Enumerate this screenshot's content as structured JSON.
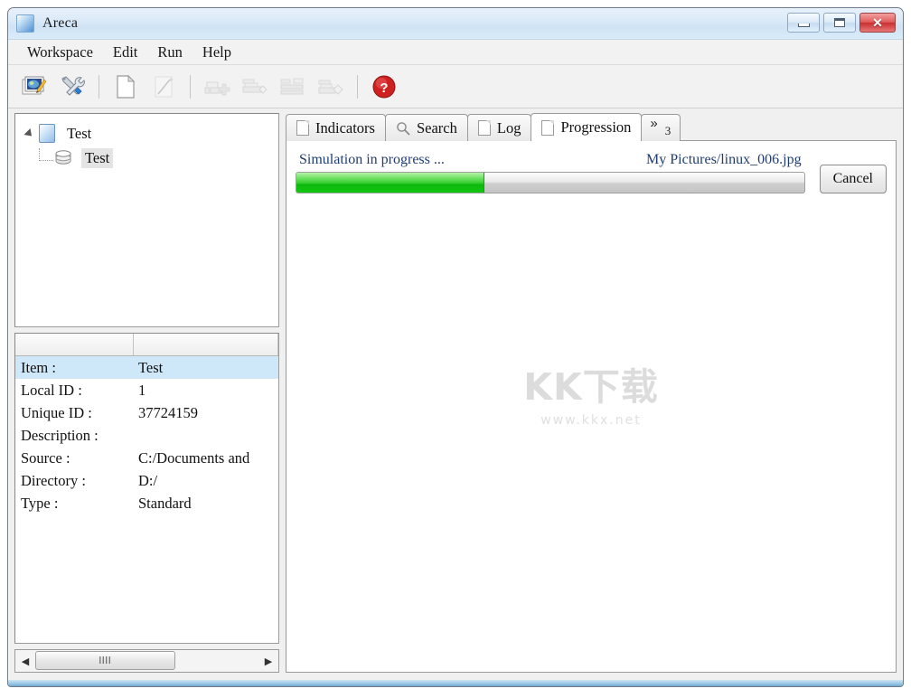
{
  "window": {
    "title": "Areca",
    "app_icon": "app-window-icon",
    "controls": [
      {
        "name": "minimize",
        "glyph": "minimize-icon"
      },
      {
        "name": "maximize",
        "glyph": "maximize-icon"
      },
      {
        "name": "close",
        "glyph": "✕"
      }
    ]
  },
  "menubar": {
    "items": [
      {
        "label": "Workspace"
      },
      {
        "label": "Edit"
      },
      {
        "label": "Run"
      },
      {
        "label": "Help"
      }
    ]
  },
  "toolbar": {
    "buttons": [
      {
        "name": "workspace-icon",
        "icon": "photo-edit-icon",
        "enabled": true
      },
      {
        "name": "preferences-icon",
        "icon": "tools-icon",
        "enabled": true
      },
      {
        "name": "new-target-icon",
        "icon": "new-document-icon",
        "enabled": true
      },
      {
        "name": "edit-target-icon",
        "icon": "pencil-icon",
        "enabled": false
      },
      {
        "name": "backup-icon",
        "icon": "archive-add-icon",
        "enabled": false
      },
      {
        "name": "simulate-icon",
        "icon": "archive-check-icon",
        "enabled": false
      },
      {
        "name": "merge-icon",
        "icon": "archive-merge-icon",
        "enabled": false
      },
      {
        "name": "recover-icon",
        "icon": "archive-recover-icon",
        "enabled": false
      },
      {
        "name": "help-icon",
        "icon": "question-mark-icon",
        "enabled": true
      }
    ]
  },
  "tree": {
    "root": {
      "label": "Test",
      "icon": "workspace-icon",
      "expanded": true
    },
    "child": {
      "label": "Test",
      "icon": "target-database-icon",
      "selected": true
    }
  },
  "properties": {
    "columns": [
      "",
      ""
    ],
    "rows": [
      {
        "key": "Item :",
        "value": "Test",
        "selected": true
      },
      {
        "key": "Local ID :",
        "value": "1",
        "selected": false
      },
      {
        "key": "Unique ID :",
        "value": "37724159",
        "selected": false
      },
      {
        "key": "Description :",
        "value": "",
        "selected": false
      },
      {
        "key": "Source :",
        "value": "C:/Documents and",
        "selected": false
      },
      {
        "key": "Directory :",
        "value": "D:/",
        "selected": false
      },
      {
        "key": "Type :",
        "value": "Standard",
        "selected": false
      }
    ]
  },
  "scrollbar": {
    "left_arrow": "◀",
    "right_arrow": "▶",
    "grip": "llll"
  },
  "tabs": [
    {
      "label": "Indicators",
      "icon": "document-icon",
      "active": false
    },
    {
      "label": "Search",
      "icon": "magnifier-icon",
      "active": false
    },
    {
      "label": "Log",
      "icon": "document-icon",
      "active": false
    },
    {
      "label": "Progression",
      "icon": "document-icon",
      "active": true
    }
  ],
  "tab_overflow": {
    "chevron": "»",
    "count": "3"
  },
  "progression": {
    "status_label": "Simulation in progress ...",
    "file_label": "My Pictures/linux_006.jpg",
    "percent": 37,
    "cancel_label": "Cancel",
    "accent_color": "#1f3d73",
    "progress_color": "#12c611"
  },
  "watermark": {
    "main": "KK下载",
    "sub": "www.kkx.net"
  }
}
